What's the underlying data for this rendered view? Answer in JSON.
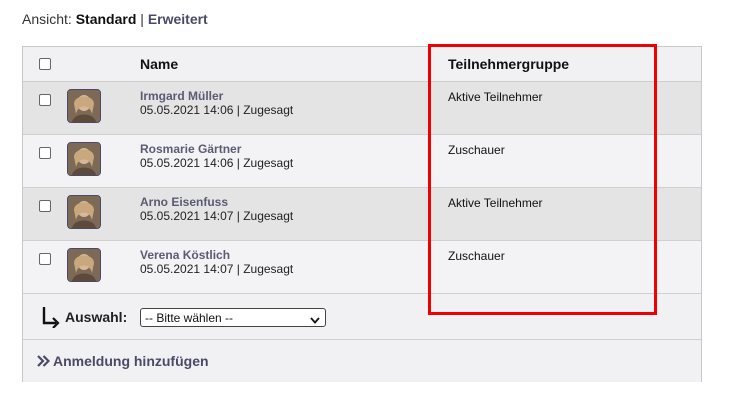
{
  "view": {
    "label": "Ansicht:",
    "standard": "Standard",
    "separator": "|",
    "extended": "Erweitert"
  },
  "table": {
    "columns": {
      "name": "Name",
      "group": "Teilnehmergruppe"
    },
    "rows": [
      {
        "name": "Irmgard Müller",
        "date": "05.05.2021 14:06",
        "status": "Zugesagt",
        "meta": "05.05.2021 14:06 | Zugesagt",
        "group": "Aktive Teilnehmer"
      },
      {
        "name": "Rosmarie Gärtner",
        "date": "05.05.2021 14:06",
        "status": "Zugesagt",
        "meta": "05.05.2021 14:06 | Zugesagt",
        "group": "Zuschauer"
      },
      {
        "name": "Arno Eisenfuss",
        "date": "05.05.2021 14:07",
        "status": "Zugesagt",
        "meta": "05.05.2021 14:07 | Zugesagt",
        "group": "Aktive Teilnehmer"
      },
      {
        "name": "Verena Köstlich",
        "date": "05.05.2021 14:07",
        "status": "Zugesagt",
        "meta": "05.05.2021 14:07 | Zugesagt",
        "group": "Zuschauer"
      }
    ]
  },
  "selection": {
    "label": "Auswahl:",
    "selected": "-- Bitte wählen --"
  },
  "add": {
    "label": "Anmeldung hinzufügen"
  },
  "colors": {
    "accent": "#4a4a68",
    "highlight": "#f00000",
    "row_odd": "#e4e4e4",
    "row_even": "#f3f3f5"
  },
  "icons": {
    "corner": "corner-down-right-icon",
    "add": "double-chevron-right-icon",
    "select": "chevron-down-icon",
    "avatar": "user-photo"
  }
}
